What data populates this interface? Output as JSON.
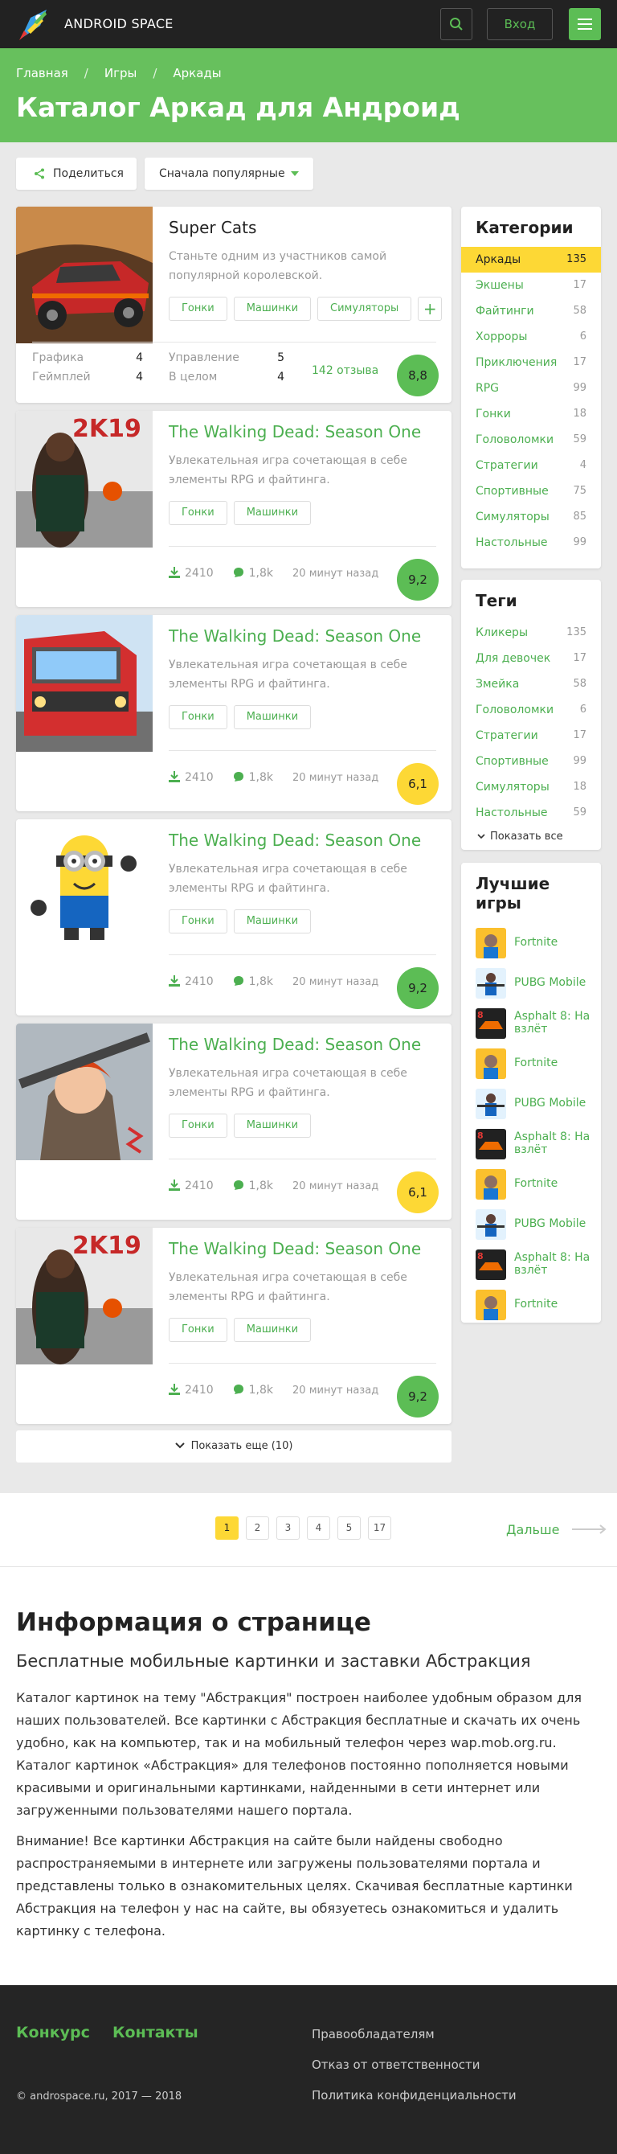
{
  "header": {
    "logo_text": "ANDROID SPACE",
    "login_label": "Вход"
  },
  "breadcrumbs": [
    "Главная",
    "Игры",
    "Аркады"
  ],
  "page_title": "Каталог Аркад для Андроид",
  "toolbar": {
    "share_label": "Поделиться",
    "sort_label": "Сначала популярные"
  },
  "featured": {
    "title": "Super Cats",
    "description": "Станьте одним из участников самой популярной королевской.",
    "tags": [
      "Гонки",
      "Машинки",
      "Симуляторы"
    ],
    "ratings": [
      {
        "label": "Графика",
        "value": "4"
      },
      {
        "label": "Геймплей",
        "value": "4"
      },
      {
        "label": "Управление",
        "value": "5"
      },
      {
        "label": "В целом",
        "value": "4"
      }
    ],
    "reviews": "142 отзыва",
    "score": "8,8"
  },
  "games": [
    {
      "title": "The Walking Dead: Season One",
      "description": "Увлекательная игра сочетающая в себе элементы RPG и файтинга.",
      "tags": [
        "Гонки",
        "Машинки"
      ],
      "downloads": "2410",
      "comments": "1,8k",
      "time": "20 минут назад",
      "score": "9,2",
      "color": "green"
    },
    {
      "title": "The Walking Dead: Season One",
      "description": "Увлекательная игра сочетающая в себе элементы RPG и файтинга.",
      "tags": [
        "Гонки",
        "Машинки"
      ],
      "downloads": "2410",
      "comments": "1,8k",
      "time": "20 минут назад",
      "score": "6,1",
      "color": "yellow"
    },
    {
      "title": "The Walking Dead: Season One",
      "description": "Увлекательная игра сочетающая в себе элементы RPG и файтинга.",
      "tags": [
        "Гонки",
        "Машинки"
      ],
      "downloads": "2410",
      "comments": "1,8k",
      "time": "20 минут назад",
      "score": "9,2",
      "color": "green"
    },
    {
      "title": "The Walking Dead: Season One",
      "description": "Увлекательная игра сочетающая в себе элементы RPG и файтинга.",
      "tags": [
        "Гонки",
        "Машинки"
      ],
      "downloads": "2410",
      "comments": "1,8k",
      "time": "20 минут назад",
      "score": "6,1",
      "color": "yellow"
    },
    {
      "title": "The Walking Dead: Season One",
      "description": "Увлекательная игра сочетающая в себе элементы RPG и файтинга.",
      "tags": [
        "Гонки",
        "Машинки"
      ],
      "downloads": "2410",
      "comments": "1,8k",
      "time": "20 минут назад",
      "score": "9,2",
      "color": "green"
    }
  ],
  "show_more_label": "Показать еще (10)",
  "categories": {
    "title": "Категории",
    "items": [
      {
        "label": "Аркады",
        "count": "135"
      },
      {
        "label": "Экшены",
        "count": "17"
      },
      {
        "label": "Файтинги",
        "count": "58"
      },
      {
        "label": "Хорроры",
        "count": "6"
      },
      {
        "label": "Приключения",
        "count": "17"
      },
      {
        "label": "RPG",
        "count": "99"
      },
      {
        "label": "Гонки",
        "count": "18"
      },
      {
        "label": "Головоломки",
        "count": "59"
      },
      {
        "label": "Стратегии",
        "count": "4"
      },
      {
        "label": "Спортивные",
        "count": "75"
      },
      {
        "label": "Симуляторы",
        "count": "85"
      },
      {
        "label": "Настольные",
        "count": "99"
      }
    ]
  },
  "tags_block": {
    "title": "Теги",
    "items": [
      {
        "label": "Кликеры",
        "count": "135"
      },
      {
        "label": "Для девочек",
        "count": "17"
      },
      {
        "label": "Змейка",
        "count": "58"
      },
      {
        "label": "Головоломки",
        "count": "6"
      },
      {
        "label": "Стратегии",
        "count": "17"
      },
      {
        "label": "Спортивные",
        "count": "99"
      },
      {
        "label": "Симуляторы",
        "count": "18"
      },
      {
        "label": "Настольные",
        "count": "59"
      }
    ],
    "show_all": "Показать все"
  },
  "best_games": {
    "title": "Лучшие игры",
    "items": [
      "Fortnite",
      "PUBG Mobile",
      "Asphalt 8: На взлёт",
      "Fortnite",
      "PUBG Mobile",
      "Asphalt 8: На взлёт",
      "Fortnite",
      "PUBG Mobile",
      "Asphalt 8: На взлёт",
      "Fortnite"
    ]
  },
  "pagination": {
    "pages": [
      "1",
      "2",
      "3",
      "4",
      "5",
      "17"
    ],
    "next_label": "Дальше"
  },
  "info": {
    "title": "Информация о странице",
    "subtitle": "Бесплатные мобильные картинки и заставки Абстракция",
    "p1": "Каталог картинок на тему \"Абстракция\" построен наиболее удобным образом для наших пользователей. Все картинки с Абстракция бесплатные и скачать их очень удобно, как на компьютер, так и на мобильный телефон через wap.mob.org.ru. Каталог картинок «Абстракция» для телефонов постоянно пополняется новыми красивыми и оригинальными картинками, найденными в сети интернет или загруженными пользователями нашего портала.",
    "p2": "Внимание! Все картинки Абстракция на сайте были найдены свободно распространяемыми в интернете или загружены пользователями портала и представлены только в ознакомительных целях. Скачивая бесплатные картинки Абстракция на телефон у нас на сайте, вы обязуетесь ознакомиться и удалить картинку с телефона."
  },
  "footer": {
    "link1": "Конкурс",
    "link2": "Контакты",
    "copyright": "© androspace.ru, 2017 — 2018",
    "links": [
      "Правообладателям",
      "Отказ от ответственности",
      "Политика конфиденциальности"
    ]
  }
}
